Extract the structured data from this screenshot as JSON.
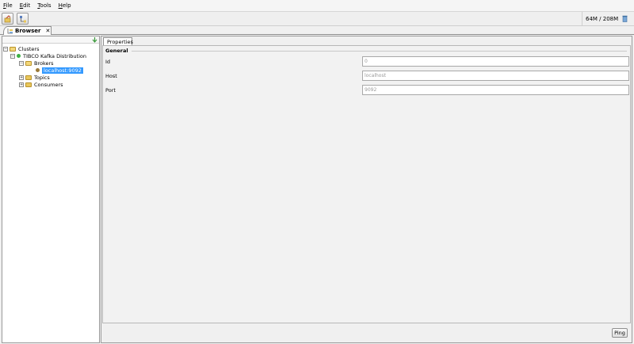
{
  "menubar": {
    "items": [
      {
        "key": "F",
        "rest": "ile"
      },
      {
        "key": "E",
        "rest": "dit"
      },
      {
        "key": "T",
        "rest": "ools"
      },
      {
        "key": "H",
        "rest": "elp"
      }
    ]
  },
  "toolbar": {
    "memory": "64M / 208M"
  },
  "main_tab": {
    "label": "Browser",
    "close": "✕"
  },
  "tree": {
    "clusters": "Clusters",
    "cluster": "TIBCO Kafka Distribution",
    "brokers": "Brokers",
    "broker": "localhost:9092",
    "topics": "Topics",
    "consumers": "Consumers"
  },
  "properties": {
    "tab_label": "Properties",
    "group": "General",
    "fields": [
      {
        "label": "Id",
        "value": "0"
      },
      {
        "label": "Host",
        "value": "localhost"
      },
      {
        "label": "Port",
        "value": "9092"
      }
    ],
    "ping_label": "Ping"
  },
  "colors": {
    "selection": "#3399ff",
    "status_green": "#3cb043",
    "folder": "#e8c65a"
  }
}
